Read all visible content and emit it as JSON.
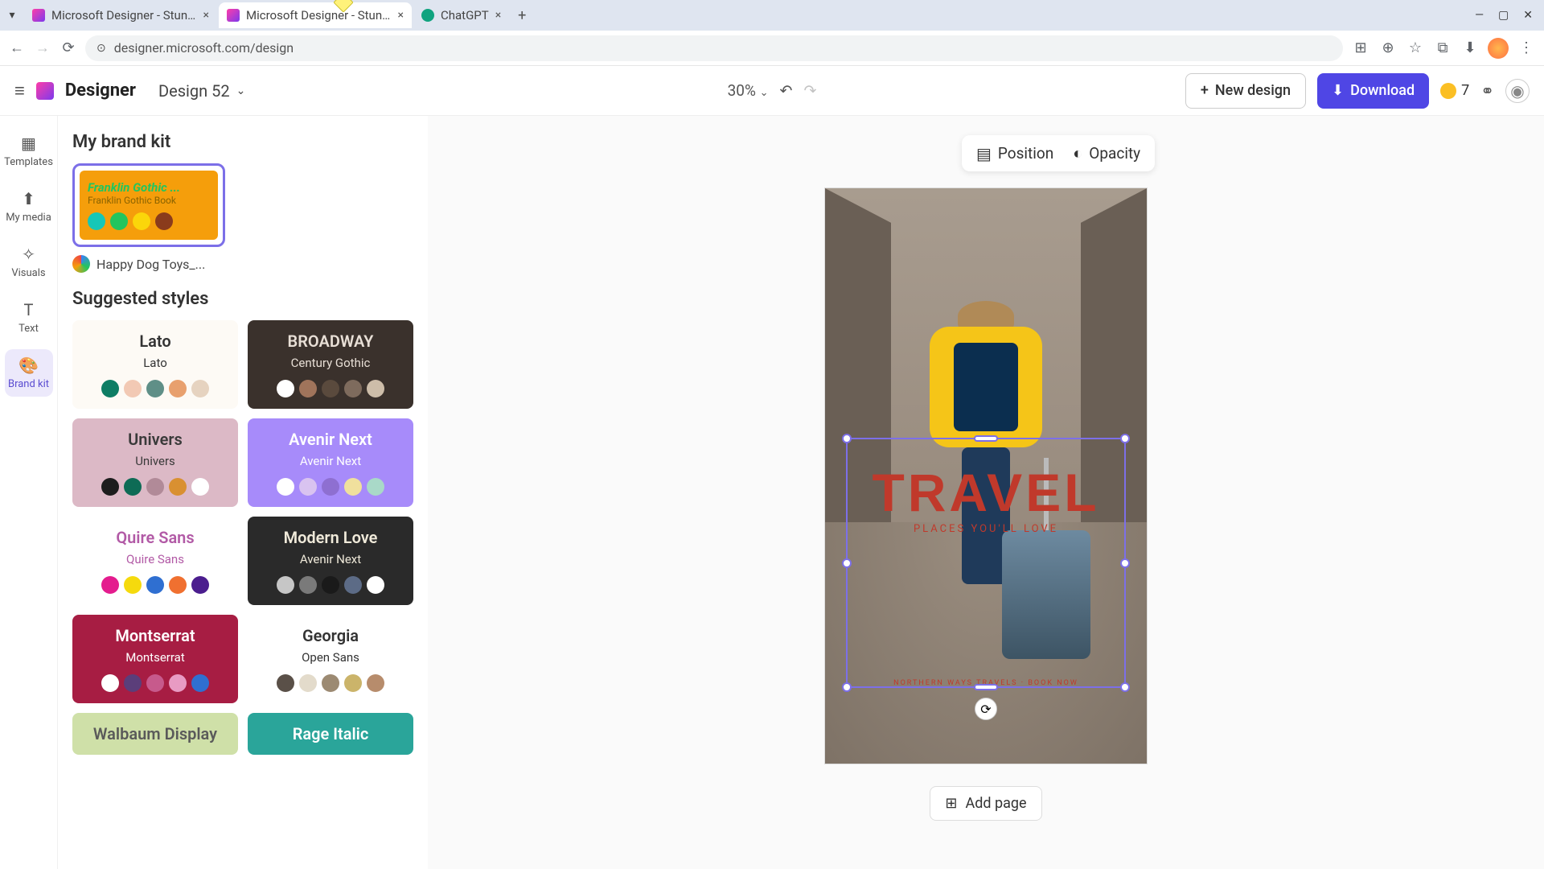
{
  "browser": {
    "tabs": [
      {
        "title": "Microsoft Designer - Stunning"
      },
      {
        "title": "Microsoft Designer - Stunning"
      },
      {
        "title": "ChatGPT"
      }
    ],
    "url": "designer.microsoft.com/design"
  },
  "header": {
    "logo_text": "Designer",
    "design_name": "Design 52",
    "zoom": "30%",
    "new_design": "New design",
    "download": "Download",
    "credits": "7"
  },
  "rail": {
    "templates": "Templates",
    "my_media": "My media",
    "visuals": "Visuals",
    "text": "Text",
    "brand_kit": "Brand kit"
  },
  "panel": {
    "my_brand_kit": "My brand kit",
    "brand_card": {
      "line1": "Franklin Gothic ...",
      "line2": "Franklin Gothic Book",
      "swatches": [
        "#16c7b7",
        "#22c55e",
        "#fbd60a",
        "#8a3b1c"
      ]
    },
    "brand_label": "Happy Dog Toys_...",
    "suggested_styles": "Suggested styles",
    "styles": [
      {
        "bg": "#fdfaf5",
        "fg": "#333",
        "f1": "Lato",
        "f2": "Lato",
        "sw": [
          "#0e7d64",
          "#f2c9b4",
          "#5f8f87",
          "#e8a06e",
          "#e6d3c0"
        ]
      },
      {
        "bg": "#3a312c",
        "fg": "#e8dfd6",
        "f1": "BROADWAY",
        "f2": "Century Gothic",
        "sw": [
          "#ffffff",
          "#a0745b",
          "#5a4a3d",
          "#7e6b5d",
          "#cdbda9"
        ]
      },
      {
        "bg": "#dcb9c6",
        "fg": "#3a3a3a",
        "f1": "Univers",
        "f2": "Univers",
        "sw": [
          "#1d1d1d",
          "#0e6b55",
          "#b18a98",
          "#d99031",
          "#ffffff"
        ]
      },
      {
        "bg": "#a78bfa",
        "fg": "#fff",
        "f1": "Avenir Next",
        "f2": "Avenir Next",
        "sw": [
          "#ffffff",
          "#d9c3f0",
          "#8e6fd1",
          "#f0e09d",
          "#a9d9c8"
        ]
      },
      {
        "bg": "#fff",
        "fg": "#b25aa6",
        "f1": "Quire Sans",
        "f2": "Quire Sans",
        "sw": [
          "#e41c8e",
          "#f5da0d",
          "#2f6fd1",
          "#f07030",
          "#4b1d8e"
        ]
      },
      {
        "bg": "#2a2a2a",
        "fg": "#f0eada",
        "f1": "Modern Love",
        "f2": "Avenir Next",
        "sw": [
          "#c6c6c6",
          "#7a7a7a",
          "#1a1a1a",
          "#5c6b86",
          "#ffffff"
        ]
      },
      {
        "bg": "#a71d43",
        "fg": "#fff",
        "f1": "Montserrat",
        "f2": "Montserrat",
        "sw": [
          "#ffffff",
          "#5b3e7a",
          "#c75a8c",
          "#e89bc3",
          "#2f6fd1"
        ]
      },
      {
        "bg": "#fff",
        "fg": "#333",
        "f1": "Georgia",
        "f2": "Open Sans",
        "sw": [
          "#5a5048",
          "#e3dbcb",
          "#9c8a72",
          "#cbb46a",
          "#b78c6c"
        ]
      },
      {
        "bg": "#cfe0a8",
        "fg": "#5a5a5a",
        "f1": "Walbaum Display",
        "f2": "",
        "sw": []
      },
      {
        "bg": "#2aa59a",
        "fg": "#fff",
        "f1": "Rage Italic",
        "f2": "",
        "sw": []
      }
    ]
  },
  "toolbar": {
    "position": "Position",
    "opacity": "Opacity"
  },
  "canvas": {
    "title": "TRAVEL",
    "subtitle": "PLACES YOU'LL LOVE",
    "footer": "NORTHERN WAYS TRAVELS · BOOK NOW"
  },
  "addpage": "Add page"
}
